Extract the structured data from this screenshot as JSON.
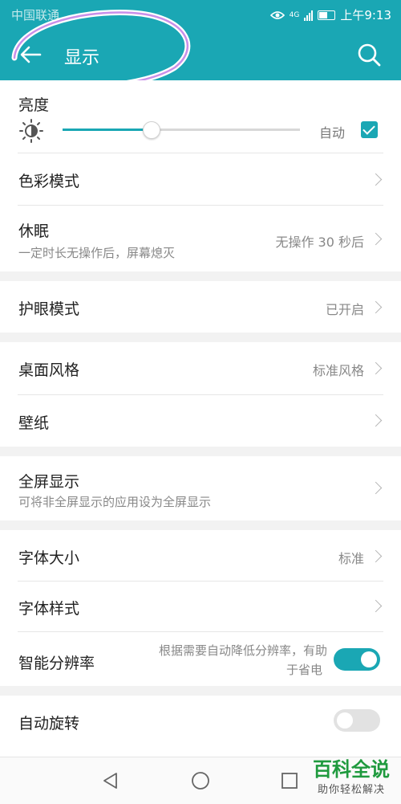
{
  "status": {
    "carrier": "中国联通",
    "net": "4G",
    "time": "上午9:13"
  },
  "appbar": {
    "title": "显示"
  },
  "brightness": {
    "label": "亮度",
    "auto_label": "自动",
    "level": 0.37,
    "auto_checked": true
  },
  "rows": {
    "color_mode": {
      "label": "色彩模式"
    },
    "sleep": {
      "label": "休眠",
      "sub": "一定时长无操作后，屏幕熄灭",
      "value": "无操作 30 秒后"
    },
    "eye_care": {
      "label": "护眼模式",
      "value": "已开启"
    },
    "desktop_style": {
      "label": "桌面风格",
      "value": "标准风格"
    },
    "wallpaper": {
      "label": "壁纸"
    },
    "fullscreen": {
      "label": "全屏显示",
      "sub": "可将非全屏显示的应用设为全屏显示"
    },
    "font_size": {
      "label": "字体大小",
      "value": "标准"
    },
    "font_style": {
      "label": "字体样式"
    },
    "resolution": {
      "label": "智能分辨率",
      "value_line1": "根据需要自动降低分辨率，有助",
      "value_line2": "于省电",
      "on": true
    },
    "auto_rotate": {
      "label": "自动旋转",
      "on": false
    }
  },
  "watermark": {
    "title": "百科全说",
    "subtitle": "助你轻松解决"
  },
  "colors": {
    "accent": "#1aa7b4",
    "annotation": "#b060e0"
  }
}
